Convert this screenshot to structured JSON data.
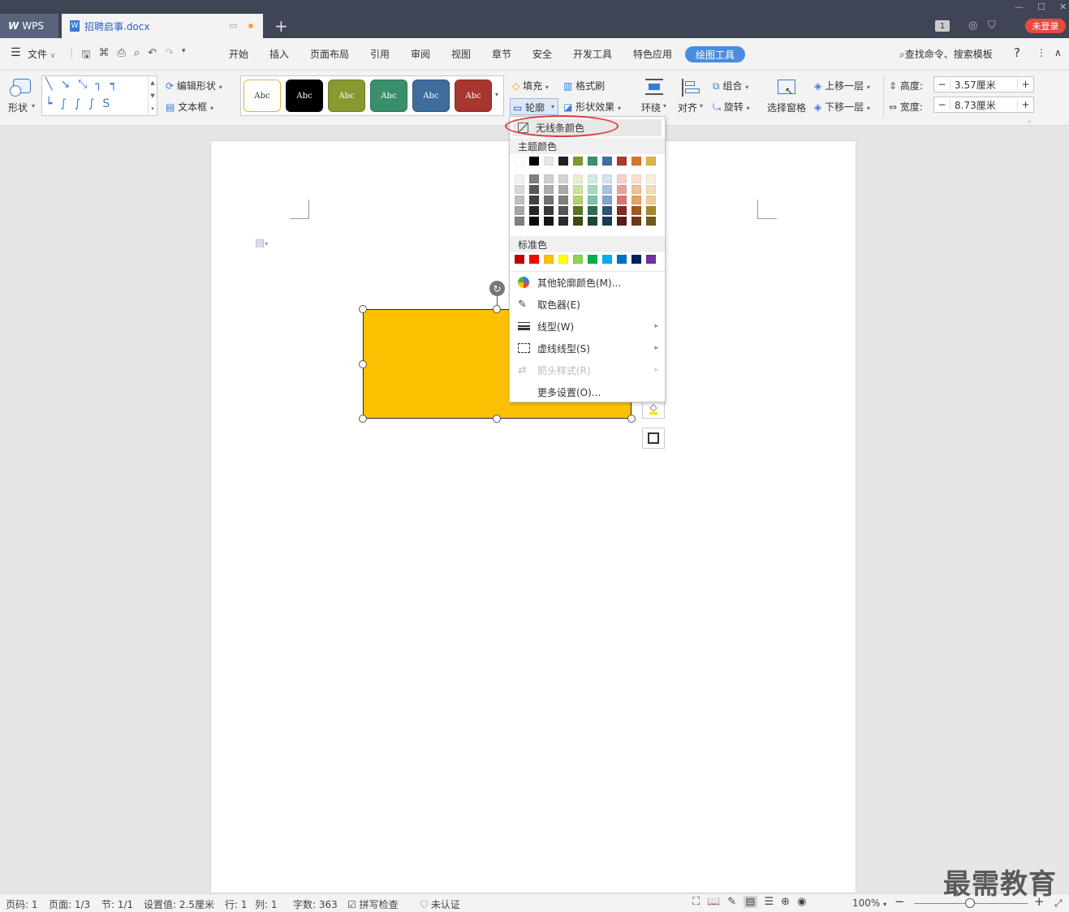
{
  "tabs": {
    "app": "WPS",
    "doc": "招聘启事.docx",
    "login": "未登录",
    "badge": "1"
  },
  "menu": {
    "file": "文件",
    "items": [
      "开始",
      "插入",
      "页面布局",
      "引用",
      "审阅",
      "视图",
      "章节",
      "安全",
      "开发工具",
      "特色应用"
    ],
    "active": "绘图工具",
    "search": "查找命令、搜索模板",
    "help": "?"
  },
  "ribbon": {
    "shape": "形状",
    "edit_shape": "编辑形状",
    "textbox": "文本框",
    "style_text": "Abc",
    "fill": "填充",
    "format_painter": "格式刷",
    "outline": "轮廓",
    "shape_effect": "形状效果",
    "wrap": "环绕",
    "align": "对齐",
    "group": "组合",
    "rotate": "旋转",
    "select_pane": "选择窗格",
    "bring_forward": "上移一层",
    "send_backward": "下移一层",
    "height_label": "高度:",
    "height_value": "3.57厘米",
    "width_label": "宽度:",
    "width_value": "8.73厘米"
  },
  "colors": {
    "style_borders": [
      "#e0b04a",
      "#000000",
      "#869a30",
      "#3a8f6a",
      "#3e6c9b",
      "#a8362e"
    ],
    "shape_fill": "#fdc000",
    "accent": "#4a8de0"
  },
  "dropdown": {
    "no_line": "无线条颜色",
    "theme_title": "主题颜色",
    "standard_title": "标准色",
    "more_colors": "其他轮廓颜色(M)...",
    "eyedropper": "取色器(E)",
    "line_type": "线型(W)",
    "dash_type": "虚线线型(S)",
    "arrow_style": "箭头样式(R)",
    "more_settings": "更多设置(O)..."
  },
  "status": {
    "page_code": "页码: 1",
    "page": "页面: 1/3",
    "section": "节: 1/1",
    "setting": "设置值: 2.5厘米",
    "row": "行: 1",
    "col": "列: 1",
    "words": "字数: 363",
    "spell": "拼写检查",
    "cert": "未认证",
    "zoom": "100%"
  },
  "watermark": "最需教育"
}
